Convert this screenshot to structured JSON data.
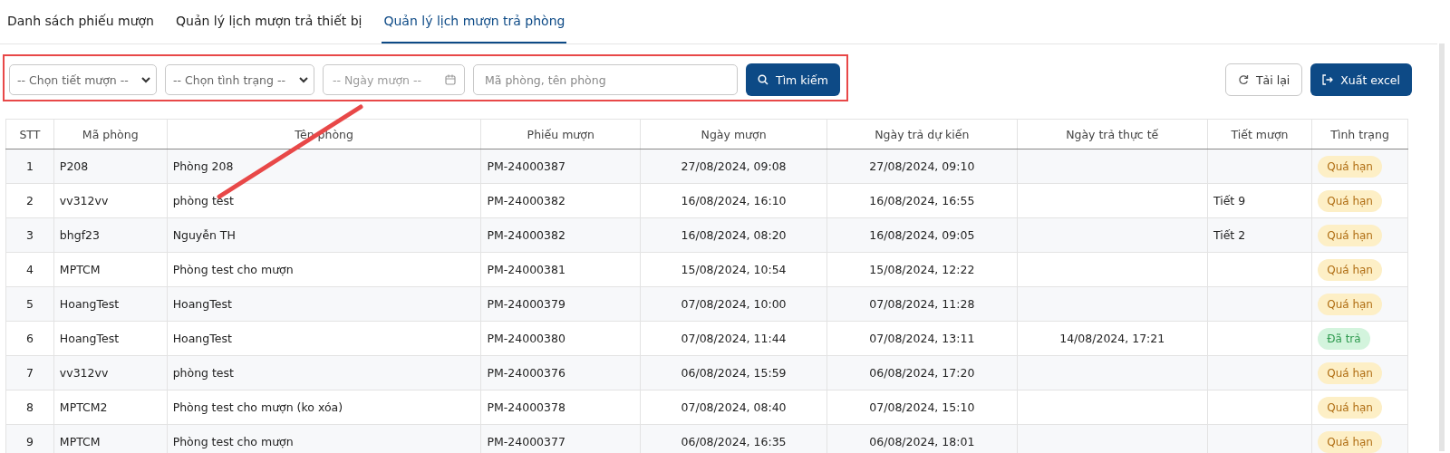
{
  "tabs": [
    {
      "label": "Danh sách phiếu mượn",
      "selected": false
    },
    {
      "label": "Quản lý lịch mượn trả thiết bị",
      "selected": false
    },
    {
      "label": "Quản lý lịch mượn trả phòng",
      "selected": true
    }
  ],
  "filters": {
    "period_select": "-- Chọn tiết mượn --",
    "status_select": "-- Chọn tình trạng --",
    "date_field": {
      "placeholder": "-- Ngày mượn --"
    },
    "search_field": {
      "placeholder": "Mã phòng, tên phòng"
    },
    "search_button": "Tìm kiếm"
  },
  "actions": {
    "reload_button": "Tải lại",
    "export_button": "Xuất excel"
  },
  "table": {
    "columns": [
      "STT",
      "Mã phòng",
      "Tên phòng",
      "Phiếu mượn",
      "Ngày mượn",
      "Ngày trả dự kiến",
      "Ngày trả thực tế",
      "Tiết mượn",
      "Tình trạng"
    ],
    "rows": [
      {
        "stt": "1",
        "room_code": "P208",
        "room_name": "Phòng 208",
        "slip": "PM-24000387",
        "borrowed": "27/08/2024, 09:08",
        "due": "27/08/2024, 09:10",
        "returned": "",
        "period": "",
        "status": {
          "label": "Quá hạn",
          "kind": "overdue"
        }
      },
      {
        "stt": "2",
        "room_code": "vv312vv",
        "room_name": "phòng test",
        "slip": "PM-24000382",
        "borrowed": "16/08/2024, 16:10",
        "due": "16/08/2024, 16:55",
        "returned": "",
        "period": "Tiết 9",
        "status": {
          "label": "Quá hạn",
          "kind": "overdue"
        }
      },
      {
        "stt": "3",
        "room_code": "bhgf23",
        "room_name": "Nguyễn TH",
        "slip": "PM-24000382",
        "borrowed": "16/08/2024, 08:20",
        "due": "16/08/2024, 09:05",
        "returned": "",
        "period": "Tiết 2",
        "status": {
          "label": "Quá hạn",
          "kind": "overdue"
        }
      },
      {
        "stt": "4",
        "room_code": "MPTCM",
        "room_name": "Phòng test cho mượn",
        "slip": "PM-24000381",
        "borrowed": "15/08/2024, 10:54",
        "due": "15/08/2024, 12:22",
        "returned": "",
        "period": "",
        "status": {
          "label": "Quá hạn",
          "kind": "overdue"
        }
      },
      {
        "stt": "5",
        "room_code": "HoangTest",
        "room_name": "HoangTest",
        "slip": "PM-24000379",
        "borrowed": "07/08/2024, 10:00",
        "due": "07/08/2024, 11:28",
        "returned": "",
        "period": "",
        "status": {
          "label": "Quá hạn",
          "kind": "overdue"
        }
      },
      {
        "stt": "6",
        "room_code": "HoangTest",
        "room_name": "HoangTest",
        "slip": "PM-24000380",
        "borrowed": "07/08/2024, 11:44",
        "due": "07/08/2024, 13:11",
        "returned": "14/08/2024, 17:21",
        "period": "",
        "status": {
          "label": "Đã trả",
          "kind": "returned"
        }
      },
      {
        "stt": "7",
        "room_code": "vv312vv",
        "room_name": "phòng test",
        "slip": "PM-24000376",
        "borrowed": "06/08/2024, 15:59",
        "due": "06/08/2024, 17:20",
        "returned": "",
        "period": "",
        "status": {
          "label": "Quá hạn",
          "kind": "overdue"
        }
      },
      {
        "stt": "8",
        "room_code": "MPTCM2",
        "room_name": "Phòng test cho mượn (ko xóa)",
        "slip": "PM-24000378",
        "borrowed": "07/08/2024, 08:40",
        "due": "07/08/2024, 15:10",
        "returned": "",
        "period": "",
        "status": {
          "label": "Quá hạn",
          "kind": "overdue"
        }
      },
      {
        "stt": "9",
        "room_code": "MPTCM",
        "room_name": "Phòng test cho mượn",
        "slip": "PM-24000377",
        "borrowed": "06/08/2024, 16:35",
        "due": "06/08/2024, 18:01",
        "returned": "",
        "period": "",
        "status": {
          "label": "Quá hạn",
          "kind": "overdue"
        }
      }
    ]
  }
}
